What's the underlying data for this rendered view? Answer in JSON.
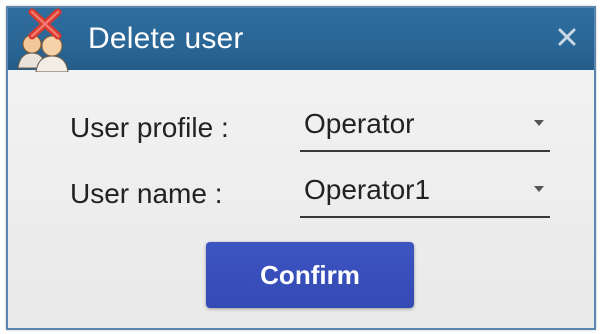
{
  "dialog": {
    "title": "Delete user",
    "icon": "users-delete-icon",
    "close_icon": "close-icon",
    "accent_color": "#2a6797"
  },
  "form": {
    "profile_label": "User profile :",
    "profile_value": "Operator",
    "name_label": "User name :",
    "name_value": "Operator1",
    "dropdown_icon": "chevron-down-icon"
  },
  "actions": {
    "confirm_label": "Confirm",
    "confirm_color": "#3449b3"
  }
}
